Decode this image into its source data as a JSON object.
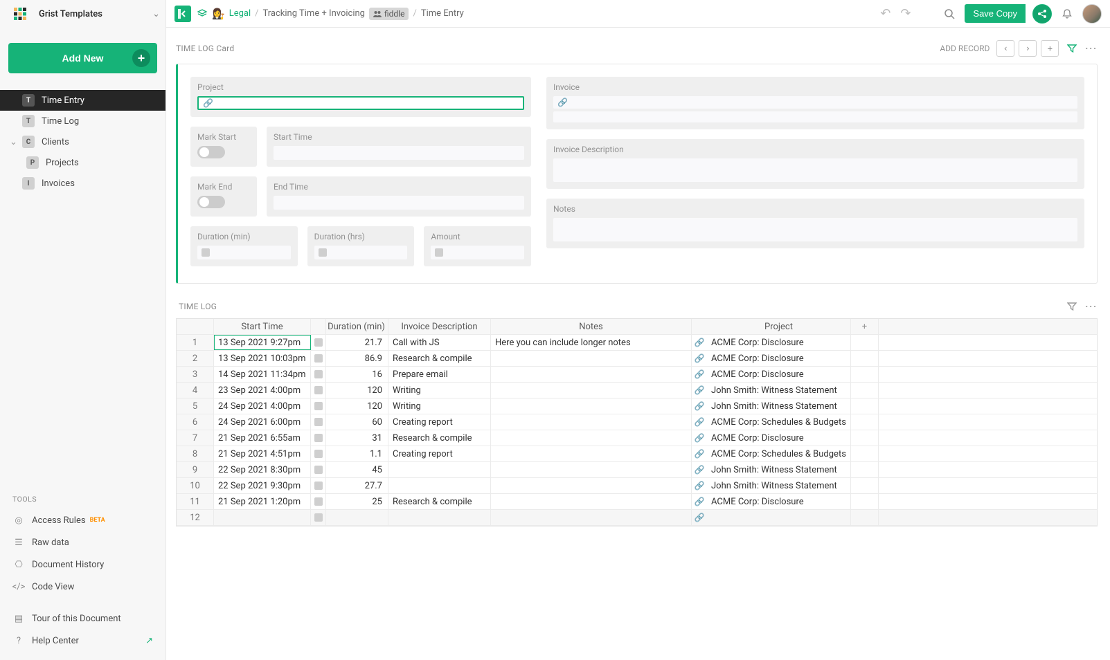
{
  "org": {
    "name": "Grist Templates"
  },
  "addnew_label": "Add New",
  "nav": [
    {
      "letter": "T",
      "label": "Time Entry",
      "active": true
    },
    {
      "letter": "T",
      "label": "Time Log"
    },
    {
      "letter": "C",
      "label": "Clients",
      "caret": true
    },
    {
      "letter": "P",
      "label": "Projects",
      "indent": true
    },
    {
      "letter": "I",
      "label": "Invoices"
    }
  ],
  "tools_heading": "TOOLS",
  "tools": {
    "access_rules": "Access Rules",
    "access_rules_badge": "BETA",
    "raw_data": "Raw data",
    "doc_history": "Document History",
    "code_view": "Code View",
    "tour": "Tour of this Document",
    "help": "Help Center"
  },
  "breadcrumb": {
    "team": "Legal",
    "doc": "Tracking Time + Invoicing",
    "fiddle_badge": "fiddle",
    "page": "Time Entry"
  },
  "topbar": {
    "savecopy": "Save Copy"
  },
  "card_section_title": "TIME LOG Card",
  "add_record_label": "ADD RECORD",
  "card_labels": {
    "project": "Project",
    "mark_start": "Mark Start",
    "start_time": "Start Time",
    "mark_end": "Mark End",
    "end_time": "End Time",
    "duration_min": "Duration (min)",
    "duration_hrs": "Duration (hrs)",
    "amount": "Amount",
    "invoice": "Invoice",
    "invoice_desc": "Invoice Description",
    "notes": "Notes"
  },
  "table_section_title": "TIME LOG",
  "table": {
    "headers": {
      "start_time": "Start Time",
      "duration_min": "Duration (min)",
      "invoice_desc": "Invoice Description",
      "notes": "Notes",
      "project": "Project"
    },
    "rows": [
      {
        "n": "1",
        "start": "13 Sep 2021 9:27pm",
        "dur": "21.7",
        "desc": "Call with JS",
        "notes": "Here you can include longer notes",
        "proj": "ACME Corp: Disclosure"
      },
      {
        "n": "2",
        "start": "13 Sep 2021 10:03pm",
        "dur": "86.9",
        "desc": "Research & compile",
        "notes": "",
        "proj": "ACME Corp: Disclosure"
      },
      {
        "n": "3",
        "start": "14 Sep 2021 11:34pm",
        "dur": "16",
        "desc": "Prepare email",
        "notes": "",
        "proj": "ACME Corp: Disclosure"
      },
      {
        "n": "4",
        "start": "23 Sep 2021 4:00pm",
        "dur": "120",
        "desc": "Writing",
        "notes": "",
        "proj": "John Smith: Witness Statement"
      },
      {
        "n": "5",
        "start": "24 Sep 2021 4:00pm",
        "dur": "120",
        "desc": "Writing",
        "notes": "",
        "proj": "John Smith: Witness Statement"
      },
      {
        "n": "6",
        "start": "24 Sep 2021 6:00pm",
        "dur": "60",
        "desc": "Creating report",
        "notes": "",
        "proj": "ACME Corp: Schedules & Budgets"
      },
      {
        "n": "7",
        "start": "21 Sep 2021 6:55am",
        "dur": "31",
        "desc": "Research & compile",
        "notes": "",
        "proj": "ACME Corp: Disclosure"
      },
      {
        "n": "8",
        "start": "21 Sep 2021 4:51pm",
        "dur": "1.1",
        "desc": "Creating report",
        "notes": "",
        "proj": "ACME Corp: Schedules & Budgets"
      },
      {
        "n": "9",
        "start": "22 Sep 2021 8:30pm",
        "dur": "45",
        "desc": "",
        "notes": "",
        "proj": "John Smith: Witness Statement"
      },
      {
        "n": "10",
        "start": "22 Sep 2021 9:30pm",
        "dur": "27.7",
        "desc": "",
        "notes": "",
        "proj": "John Smith: Witness Statement"
      },
      {
        "n": "11",
        "start": "21 Sep 2021 1:20pm",
        "dur": "25",
        "desc": "Research & compile",
        "notes": "",
        "proj": "ACME Corp: Disclosure"
      }
    ],
    "newrow_n": "12"
  }
}
